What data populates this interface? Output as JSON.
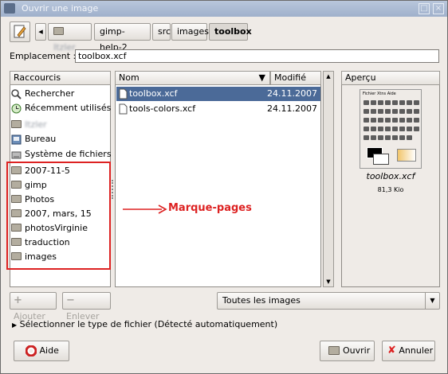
{
  "window": {
    "title": "Ouvrir une image"
  },
  "path": {
    "back": "◂",
    "home": "Itzler",
    "buttons": [
      "gimp-help-2",
      "src",
      "images",
      "toolbox"
    ]
  },
  "location": {
    "label": "Emplacement :",
    "value": "toolbox.xcf"
  },
  "places": {
    "header": "Raccourcis",
    "system": [
      "Rechercher",
      "Récemment utilisés",
      "Itzler",
      "Bureau",
      "Système de fichiers"
    ],
    "bookmarks": [
      "2007-11-5",
      "gimp",
      "Photos",
      "2007, mars, 15",
      "photosVirginie",
      "traduction",
      "images"
    ]
  },
  "files": {
    "col_name": "Nom",
    "col_modified": "Modifié",
    "rows": [
      {
        "name": "toolbox.xcf",
        "date": "24.11.2007"
      },
      {
        "name": "tools-colors.xcf",
        "date": "24.11.2007"
      }
    ]
  },
  "preview": {
    "header": "Aperçu",
    "filename": "toolbox.xcf",
    "size": "81,3 Kio",
    "menu": [
      "Fichier",
      "Xtns",
      "Aide"
    ]
  },
  "annotation": {
    "text": "Marque-pages",
    "color": "#dd2222"
  },
  "buttons": {
    "add": "Ajouter",
    "remove": "Enlever",
    "help": "Aide",
    "open": "Ouvrir",
    "cancel": "Annuler"
  },
  "filter": {
    "value": "Toutes les images"
  },
  "filetype": {
    "label": "Sélectionner le type de fichier (Détecté automatiquement)"
  }
}
